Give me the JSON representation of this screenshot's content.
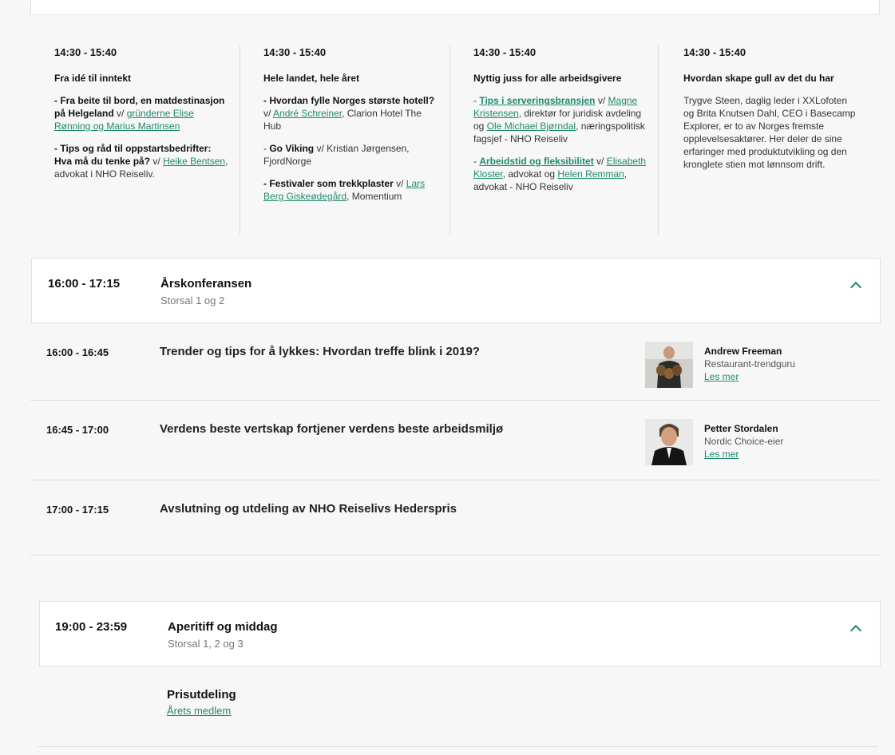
{
  "parallel_sessions": [
    {
      "time": "14:30 - 15:40",
      "title": "Fra idé til inntekt",
      "items": [
        [
          {
            "t": "- Fra beite til bord, en matdestinasjon på Helgeland",
            "b": true
          },
          {
            "t": " v/ "
          },
          {
            "t": "gründerne Elise Rønning og Marius Martinsen",
            "link": true
          }
        ],
        [
          {
            "t": "- Tips og råd til oppstartsbedrifter: Hva må du tenke på?",
            "b": true
          },
          {
            "t": " v/ "
          },
          {
            "t": "Heike Bentsen",
            "link": true
          },
          {
            "t": ", advokat i NHO Reiseliv."
          }
        ]
      ]
    },
    {
      "time": "14:30 - 15:40",
      "title": "Hele landet, hele året",
      "items": [
        [
          {
            "t": "- Hvordan fylle Norges største hotell?",
            "b": true
          },
          {
            "t": " v/ "
          },
          {
            "t": "André Schreiner",
            "link": true
          },
          {
            "t": ", Clarion Hotel The Hub"
          }
        ],
        [
          {
            "t": "- "
          },
          {
            "t": "Go Viking",
            "b": true
          },
          {
            "t": " v/ Kristian Jørgensen, FjordNorge"
          }
        ],
        [
          {
            "t": "- Festivaler som trekkplaster",
            "b": true
          },
          {
            "t": " v/ "
          },
          {
            "t": "Lars Berg Giskeødegård",
            "link": true
          },
          {
            "t": ", Momentium"
          }
        ]
      ]
    },
    {
      "time": "14:30 - 15:40",
      "title": "Nyttig juss for alle arbeidsgivere",
      "items": [
        [
          {
            "t": "- "
          },
          {
            "t": "Tips i serveringsbransjen",
            "b": true,
            "link": true
          },
          {
            "t": " v/ "
          },
          {
            "t": "Magne Kristensen",
            "link": true
          },
          {
            "t": ", direktør for juridisk avdeling og "
          },
          {
            "t": "Ole Michael Bjørndal",
            "link": true
          },
          {
            "t": ", næringspolitisk fagsjef - NHO Reiseliv"
          }
        ],
        [
          {
            "t": "- "
          },
          {
            "t": "Arbeidstid og fleksibilitet",
            "b": true,
            "link": true
          },
          {
            "t": " v/ "
          },
          {
            "t": "Elisabeth Kloster",
            "link": true
          },
          {
            "t": ", advokat og "
          },
          {
            "t": "Helen Remman",
            "link": true
          },
          {
            "t": ", advokat - NHO Reiseliv"
          }
        ]
      ]
    },
    {
      "time": "14:30 - 15:40",
      "title": "Hvordan skape gull av det du har",
      "items": [
        [
          {
            "t": "Trygve Steen, daglig leder i XXLofoten og Brita Knutsen Dahl, CEO i Basecamp Explorer, er to av Norges fremste opplevelsesaktører. Her deler de sine erfaringer med produktutvikling og den kronglete stien mot lønnsom drift."
          }
        ]
      ]
    }
  ],
  "block1": {
    "time": "16:00 - 17:15",
    "title": "Årskonferansen",
    "subtitle": "Storsal 1 og 2",
    "rows": [
      {
        "time": "16:00 - 16:45",
        "title": "Trender og tips for å lykkes: Hvordan treffe blink i 2019?",
        "speaker": {
          "name": "Andrew Freeman",
          "role": "Restaurant-trendguru",
          "link": "Les mer"
        }
      },
      {
        "time": "16:45 - 17:00",
        "title": "Verdens beste vertskap fortjener verdens beste arbeidsmiljø",
        "speaker": {
          "name": "Petter Stordalen",
          "role": "Nordic Choice-eier",
          "link": "Les mer"
        }
      },
      {
        "time": "17:00 - 17:15",
        "title": "Avslutning og utdeling av NHO Reiselivs Hederspris"
      }
    ]
  },
  "block2": {
    "time": "19:00 - 23:59",
    "title": "Aperitiff og middag",
    "subtitle": "Storsal 1, 2 og 3",
    "prize_title": "Prisutdeling",
    "prize_link": "Årets medlem"
  },
  "colors": {
    "accent": "#1e8a6e",
    "border": "#e0e0e0",
    "background": "#f7f7f7"
  },
  "icons": {
    "collapse": "chevron-up-icon"
  }
}
